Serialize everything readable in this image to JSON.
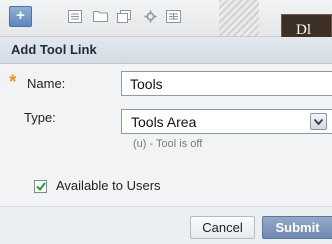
{
  "toolbar": {
    "add_button": "+",
    "icons": [
      "list-icon",
      "folder-icon",
      "window-icon",
      "tools-icon",
      "grid-icon"
    ],
    "dark_tab_text": "Dl"
  },
  "dialog": {
    "title": "Add Tool Link",
    "required_marker": "*",
    "name_label": "Name:",
    "name_value": "Tools",
    "type_label": "Type:",
    "type_selected": "Tools Area",
    "type_hint": "(u) - Tool is off",
    "available_label": "Available to Users",
    "available_checked": true,
    "cancel_label": "Cancel",
    "submit_label": "Submit"
  },
  "colors": {
    "required_star": "#f0941e",
    "submit_button": "#7f96bb",
    "header_bg": "#dbe2ea"
  }
}
